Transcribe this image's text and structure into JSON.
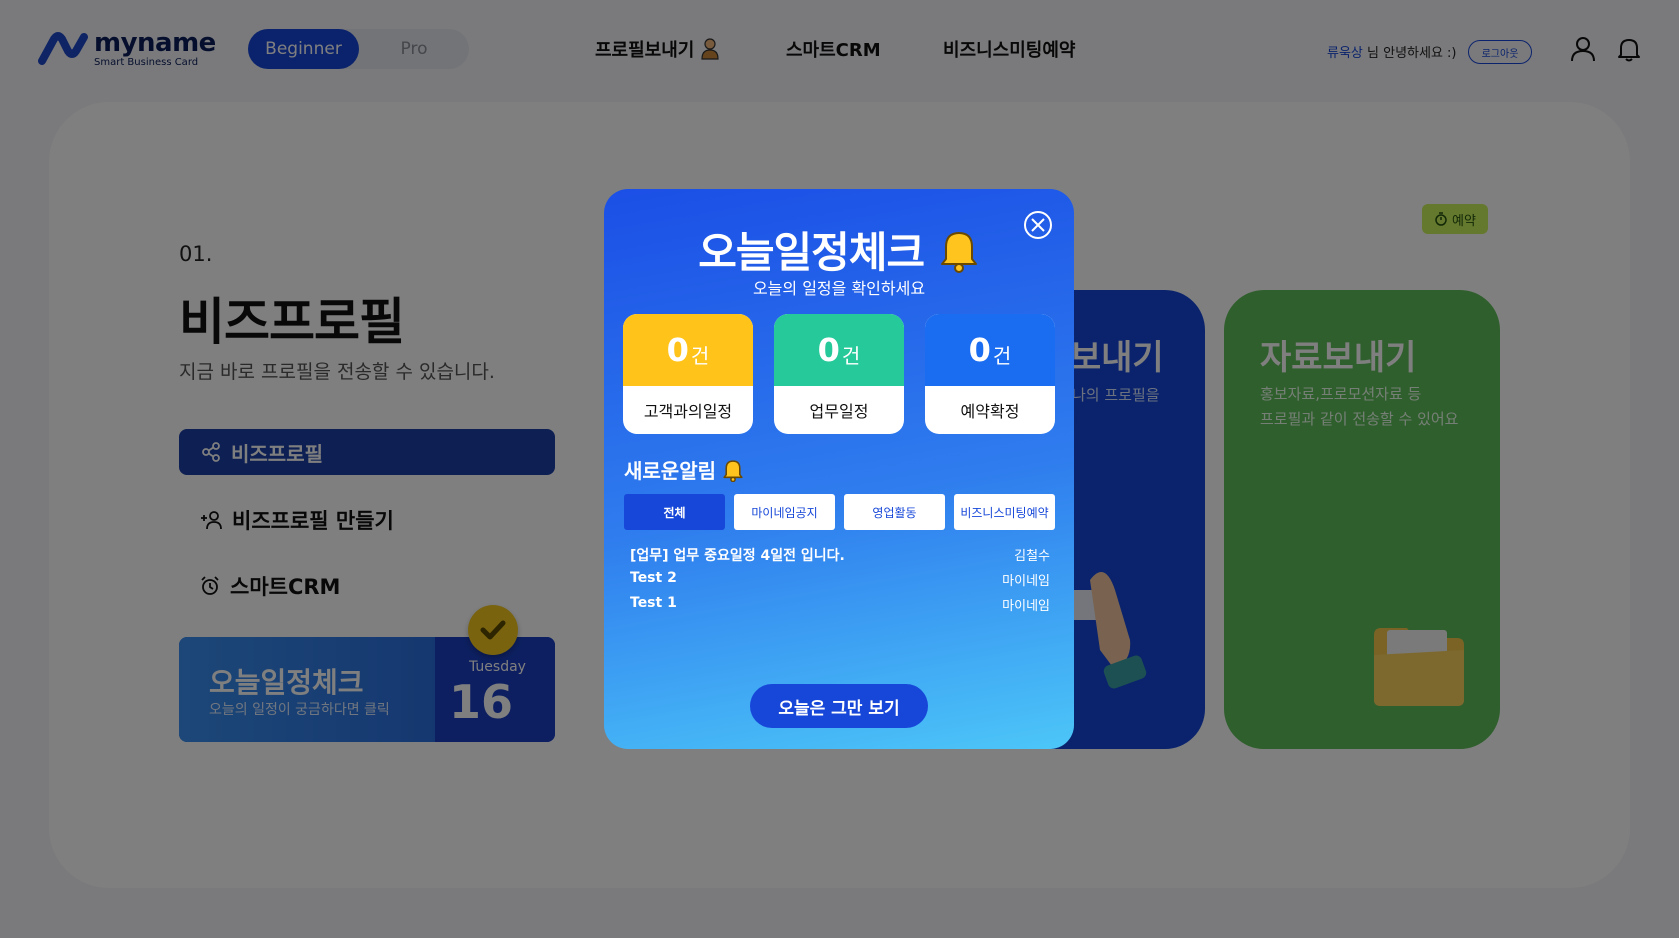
{
  "header": {
    "logo_name": "myname",
    "logo_sub": "Smart Business Card",
    "mode_beginner": "Beginner",
    "mode_pro": "Pro",
    "nav": [
      "프로필보내기",
      "스마트CRM",
      "비즈니스미팅예약"
    ],
    "user_name": "류욱상",
    "greeting_suffix": " 님 안녕하세요 :)",
    "logout_label": "로그아웃"
  },
  "section": {
    "number": "01.",
    "title": "비즈프로필",
    "description": "지금 바로 프로필을 전송할 수 있습니다.",
    "menu": [
      "비즈프로필",
      "비즈프로필 만들기",
      "스마트CRM"
    ]
  },
  "today_card": {
    "title": "오늘일정체크",
    "subtitle": "오늘의 일정이 궁금하다면 클릭",
    "weekday": "Tuesday",
    "date": "16일"
  },
  "cards": {
    "reserve_badge": "예약",
    "blue_title": "프로필보내기",
    "blue_desc": "나의 프로필을",
    "green_title": "자료보내기",
    "green_desc_1": "홍보자료,프로모션자료 등",
    "green_desc_2": "프로필과 같이 전송할 수 있어요"
  },
  "modal": {
    "title": "오늘일정체크",
    "subtitle": "오늘의 일정을 확인하세요",
    "stats": [
      {
        "count": "0",
        "unit": "건",
        "label": "고객과의일정",
        "color": "#ffc31a"
      },
      {
        "count": "0",
        "unit": "건",
        "label": "업무일정",
        "color": "#26c99a"
      },
      {
        "count": "0",
        "unit": "건",
        "label": "예약확정",
        "color": "#1a6cf0"
      }
    ],
    "news_title": "새로운알림",
    "filters": [
      "전체",
      "마이네임공지",
      "영업활동",
      "비즈니스미팅예약"
    ],
    "news": [
      {
        "text": "[업무] 업무 중요일정 4일전 입니다.",
        "author": "김철수"
      },
      {
        "text": "Test 2",
        "author": "마이네임"
      },
      {
        "text": "Test 1",
        "author": "마이네임"
      }
    ],
    "close_today": "오늘은 그만 보기"
  }
}
